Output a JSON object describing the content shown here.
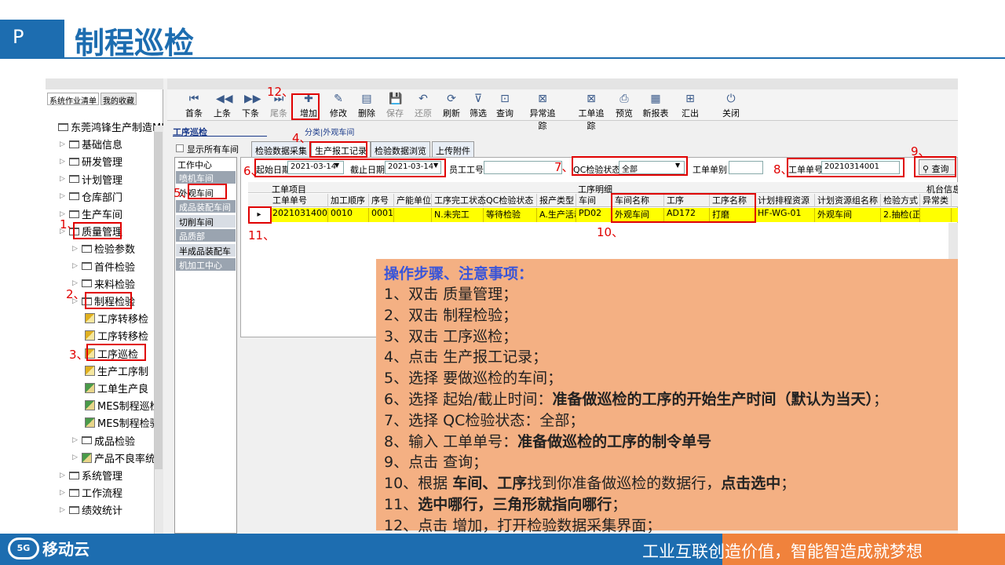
{
  "slide": {
    "badge": "P",
    "title": "制程巡检",
    "slogan": "工业互联创造价值，智能智造成就梦想",
    "logo": "移动云",
    "logo_mark": "5G"
  },
  "app": {
    "left_tabs": [
      "系统作业清单",
      "我的收藏"
    ],
    "tree": [
      {
        "label": "东莞鸿锋生产制造MI",
        "level": 0
      },
      {
        "label": "基础信息",
        "level": 1
      },
      {
        "label": "研发管理",
        "level": 1
      },
      {
        "label": "计划管理",
        "level": 1
      },
      {
        "label": "仓库部门",
        "level": 1
      },
      {
        "label": "生产车间",
        "level": 1
      },
      {
        "label": "质量管理",
        "level": 1
      },
      {
        "label": "检验参数",
        "level": 2
      },
      {
        "label": "首件检验",
        "level": 2
      },
      {
        "label": "来料检验",
        "level": 2
      },
      {
        "label": "制程检验",
        "level": 2
      },
      {
        "label": "工序转移检",
        "level": 3
      },
      {
        "label": "工序转移检",
        "level": 3
      },
      {
        "label": "工序巡检",
        "level": 3
      },
      {
        "label": "生产工序制",
        "level": 3
      },
      {
        "label": "工单生产良",
        "level": 3
      },
      {
        "label": "MES制程巡检",
        "level": 3
      },
      {
        "label": "MES制程检验",
        "level": 3
      },
      {
        "label": "成品检验",
        "level": 2
      },
      {
        "label": "产品不良率统",
        "level": 2
      },
      {
        "label": "系统管理",
        "level": 1
      },
      {
        "label": "工作流程",
        "level": 1
      },
      {
        "label": "绩效统计",
        "level": 1
      }
    ],
    "toolbar": [
      "首条",
      "上条",
      "下条",
      "尾条",
      "增加",
      "修改",
      "删除",
      "保存",
      "还原",
      "刷新",
      "筛选",
      "查询",
      "异常追踪",
      "工单追踪",
      "预览",
      "新报表",
      "汇出",
      "关闭"
    ],
    "toolbar_icons": [
      "first-icon",
      "prev-icon",
      "next-icon",
      "last-icon",
      "add-icon",
      "edit-icon",
      "delete-icon",
      "save-icon",
      "undo-icon",
      "refresh-icon",
      "filter-icon",
      "query-icon",
      "exception-trace-icon",
      "order-trace-icon",
      "preview-icon",
      "new-report-icon",
      "export-icon",
      "close-icon"
    ],
    "module_title": "工序巡检",
    "category": "分类|外观车间",
    "show_all": "显示所有车间",
    "tabs": [
      "检验数据采集",
      "生产报工记录",
      "检验数据浏览",
      "上传附件"
    ],
    "work_center": "工作中心",
    "departments": [
      "喷机车间",
      "外观车间",
      "成品装配车间",
      "切削车间",
      "品质部",
      "半成品装配车",
      "机加工中心"
    ],
    "filters": {
      "start_label": "起始日期",
      "start_value": "2021-03-14",
      "end_label": "截止日期",
      "end_value": "2021-03-14",
      "emp_label": "员工工号",
      "qc_label": "QC检验状态",
      "qc_value": "全部",
      "type_label": "工单单别",
      "order_label": "工单单号",
      "order_value": "20210314001",
      "query_button": "查询"
    },
    "group_headers": {
      "item": "工单项目",
      "detail": "工序明细",
      "machine": "机台信息"
    },
    "columns": [
      "工单单号",
      "加工顺序",
      "序号",
      "产能单位",
      "工序完工状态",
      "QC检验状态",
      "报产类型",
      "车间",
      "车间名称",
      "工序",
      "工序名称",
      "计划排程资源",
      "计划资源组名称",
      "检验方式",
      "异常类"
    ],
    "row": [
      "20210314001",
      "0010",
      "0001",
      "",
      "N.未完工",
      "等待检验",
      "A.生产活动",
      "PD02",
      "外观车间",
      "AD172",
      "打磨",
      "HF-WG-01",
      "外观车间",
      "2.抽检(正常)",
      ""
    ]
  },
  "callouts": [
    "1、",
    "2、",
    "3、",
    "4、",
    "5、",
    "6、",
    "7、",
    "8、",
    "9、",
    "10、",
    "11、",
    "12、"
  ],
  "notes": {
    "title": "操作步骤、注意事项：",
    "lines": [
      {
        "a": "1、双击 质量管理；",
        "b": "",
        "c": ""
      },
      {
        "a": "2、双击 制程检验；",
        "b": "",
        "c": ""
      },
      {
        "a": "3、双击 工序巡检；",
        "b": "",
        "c": ""
      },
      {
        "a": "4、点击 生产报工记录；",
        "b": "",
        "c": ""
      },
      {
        "a": "5、选择 要做巡检的车间；",
        "b": "",
        "c": ""
      },
      {
        "a": "6、选择 起始/截止时间：",
        "b": "准备做巡检的工序的开始生产时间（默认为当天）",
        "c": "；"
      },
      {
        "a": "7、选择 QC检验状态：全部；",
        "b": "",
        "c": ""
      },
      {
        "a": "8、输入 工单单号：",
        "b": "准备做巡检的工序的制令单号",
        "c": ""
      },
      {
        "a": "9、点击 查询；",
        "b": "",
        "c": ""
      },
      {
        "a": "10、根据 ",
        "b": "车间、工序",
        "c": "找到你准备做巡检的数据行，"
      },
      {
        "a": "11、",
        "b": "选中哪行，三角形就指向哪行",
        "c": "；"
      },
      {
        "a": "12、点击 增加，打开检验数据采集界面；",
        "b": "",
        "c": ""
      }
    ],
    "line10_tail": "点击选中",
    "line10_end": "；"
  }
}
